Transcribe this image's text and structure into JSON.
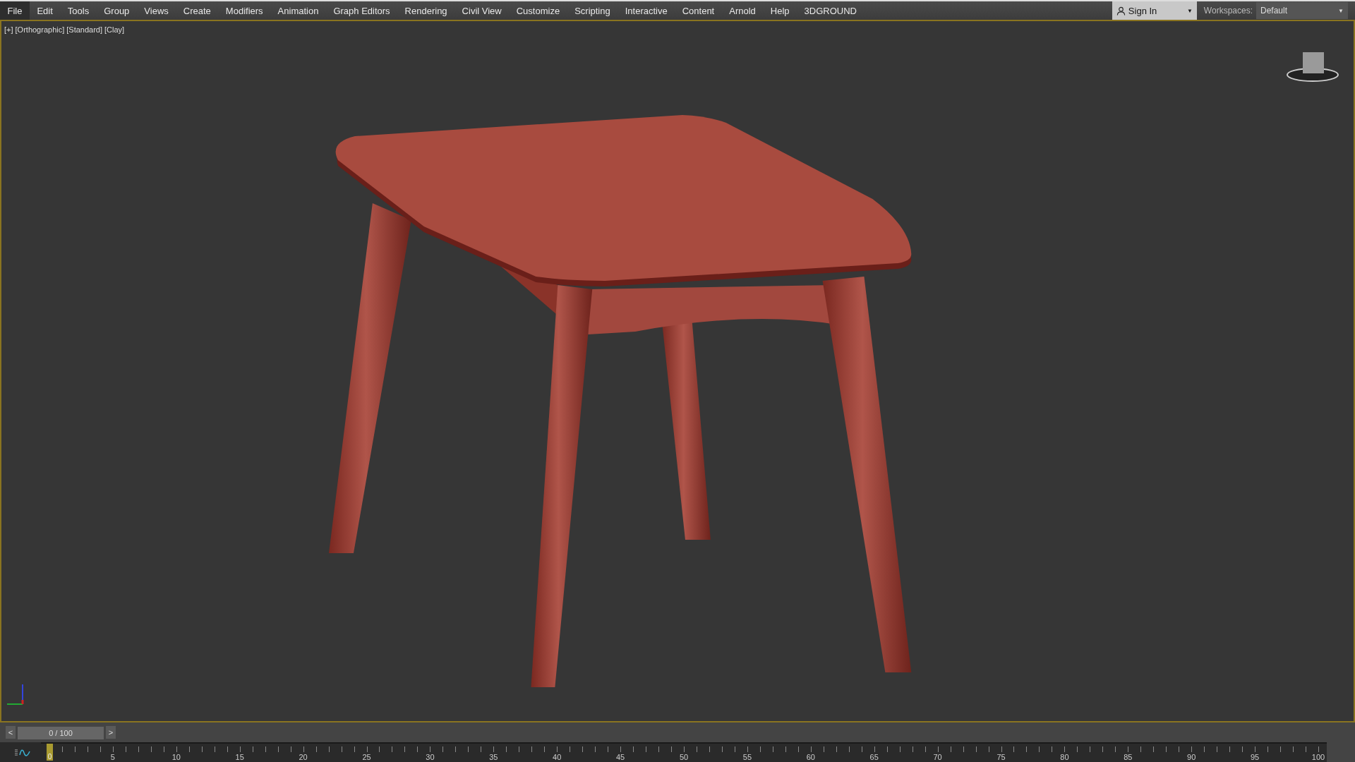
{
  "menu_bar": {
    "items": [
      {
        "label": "File",
        "selected": true
      },
      {
        "label": "Edit",
        "selected": false
      },
      {
        "label": "Tools",
        "selected": false
      },
      {
        "label": "Group",
        "selected": false
      },
      {
        "label": "Views",
        "selected": false
      },
      {
        "label": "Create",
        "selected": false
      },
      {
        "label": "Modifiers",
        "selected": false
      },
      {
        "label": "Animation",
        "selected": false
      },
      {
        "label": "Graph Editors",
        "selected": false
      },
      {
        "label": "Rendering",
        "selected": false
      },
      {
        "label": "Civil View",
        "selected": false
      },
      {
        "label": "Customize",
        "selected": false
      },
      {
        "label": "Scripting",
        "selected": false
      },
      {
        "label": "Interactive",
        "selected": false
      },
      {
        "label": "Content",
        "selected": false
      },
      {
        "label": "Arnold",
        "selected": false
      },
      {
        "label": "Help",
        "selected": false
      },
      {
        "label": "3DGROUND",
        "selected": false
      }
    ],
    "sign_in": {
      "label": "Sign In",
      "caret": "▼"
    },
    "workspaces": {
      "label": "Workspaces:",
      "value": "Default",
      "caret": "▼"
    }
  },
  "viewport": {
    "labels": [
      "[+]",
      "[Orthographic]",
      "[Standard]",
      "[Clay]"
    ]
  },
  "time_slider": {
    "prev": "<",
    "next": ">",
    "value": "0 / 100"
  },
  "track_bar": {
    "labels": [
      "0",
      "5",
      "10",
      "15",
      "20",
      "25",
      "30",
      "35",
      "40",
      "45",
      "50",
      "55",
      "60",
      "65",
      "70",
      "75",
      "80",
      "85",
      "90",
      "95",
      "100"
    ]
  }
}
